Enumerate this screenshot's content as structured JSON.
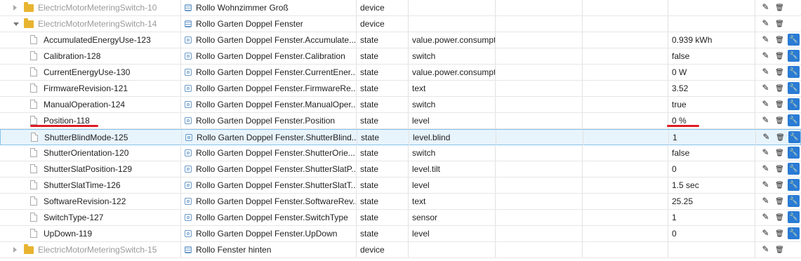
{
  "rows": [
    {
      "kind": "device",
      "expanded": false,
      "name": "ElectricMotorMeteringSwitch-10",
      "label": "Rollo Wohnzimmer Groß",
      "type": "device",
      "role": "",
      "value": "",
      "icon_state": "collapsed"
    },
    {
      "kind": "device",
      "expanded": true,
      "name": "ElectricMotorMeteringSwitch-14",
      "label": "Rollo Garten Doppel Fenster",
      "type": "device",
      "role": "",
      "value": ""
    },
    {
      "kind": "state",
      "name": "AccumulatedEnergyUse-123",
      "label": "Rollo Garten Doppel Fenster.Accumulate...",
      "type": "state",
      "role": "value.power.consumpt",
      "value": "0.939 kWh"
    },
    {
      "kind": "state",
      "name": "Calibration-128",
      "label": "Rollo Garten Doppel Fenster.Calibration",
      "type": "state",
      "role": "switch",
      "value": "false"
    },
    {
      "kind": "state",
      "name": "CurrentEnergyUse-130",
      "label": "Rollo Garten Doppel Fenster.CurrentEner...",
      "type": "state",
      "role": "value.power.consumpt",
      "value": "0 W"
    },
    {
      "kind": "state",
      "name": "FirmwareRevision-121",
      "label": "Rollo Garten Doppel Fenster.FirmwareRe...",
      "type": "state",
      "role": "text",
      "value": "3.52"
    },
    {
      "kind": "state",
      "name": "ManualOperation-124",
      "label": "Rollo Garten Doppel Fenster.ManualOper...",
      "type": "state",
      "role": "switch",
      "value": "true"
    },
    {
      "kind": "state",
      "name": "Position-118",
      "label": "Rollo Garten Doppel Fenster.Position",
      "type": "state",
      "role": "level",
      "value": "0 %"
    },
    {
      "kind": "state",
      "name": "ShutterBlindMode-125",
      "label": "Rollo Garten Doppel Fenster.ShutterBlind...",
      "type": "state",
      "role": "level.blind",
      "value": "1",
      "selected": true
    },
    {
      "kind": "state",
      "name": "ShutterOrientation-120",
      "label": "Rollo Garten Doppel Fenster.ShutterOrie...",
      "type": "state",
      "role": "switch",
      "value": "false"
    },
    {
      "kind": "state",
      "name": "ShutterSlatPosition-129",
      "label": "Rollo Garten Doppel Fenster.ShutterSlatP...",
      "type": "state",
      "role": "level.tilt",
      "value": "0"
    },
    {
      "kind": "state",
      "name": "ShutterSlatTime-126",
      "label": "Rollo Garten Doppel Fenster.ShutterSlatT...",
      "type": "state",
      "role": "level",
      "value": "1.5 sec"
    },
    {
      "kind": "state",
      "name": "SoftwareRevision-122",
      "label": "Rollo Garten Doppel Fenster.SoftwareRev...",
      "type": "state",
      "role": "text",
      "value": "25.25"
    },
    {
      "kind": "state",
      "name": "SwitchType-127",
      "label": "Rollo Garten Doppel Fenster.SwitchType",
      "type": "state",
      "role": "sensor",
      "value": "1"
    },
    {
      "kind": "state",
      "name": "UpDown-119",
      "label": "Rollo Garten Doppel Fenster.UpDown",
      "type": "state",
      "role": "level",
      "value": "0"
    },
    {
      "kind": "device",
      "expanded": false,
      "name": "ElectricMotorMeteringSwitch-15",
      "label": "Rollo Fenster hinten",
      "type": "device",
      "role": "",
      "value": ""
    }
  ],
  "actions": {
    "edit_glyph": "✎",
    "delete_glyph": "🗑",
    "tool_glyph": "🔧",
    "edit_icon": "pencil-icon",
    "delete_icon": "trash-icon",
    "tool_icon": "wrench-icon"
  },
  "colors": {
    "tool_button": "#2a7bd4",
    "folder": "#e8b430",
    "annotation": "#e01b24",
    "selected_row": "#e8f4fc"
  }
}
